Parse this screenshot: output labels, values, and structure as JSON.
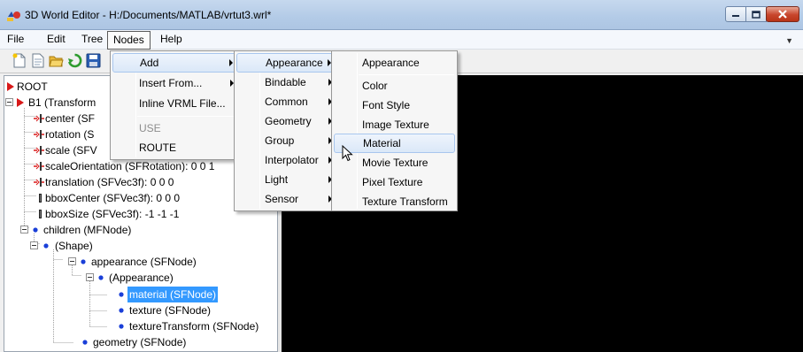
{
  "window": {
    "title": "3D World Editor - H:/Documents/MATLAB/vrtut3.wrl*"
  },
  "menubar": {
    "items": [
      "File",
      "Edit",
      "Tree",
      "Nodes",
      "Help"
    ],
    "active": "Nodes"
  },
  "tree": {
    "root": "ROOT",
    "rows": [
      "B1 (Transform",
      "center (SF",
      "rotation (S",
      "scale (SFV",
      "scaleOrientation (SFRotation): 0 0 1",
      "translation (SFVec3f): 0 0 0",
      "bboxCenter (SFVec3f): 0 0 0",
      "bboxSize (SFVec3f): -1 -1 -1",
      "children (MFNode)",
      "(Shape)",
      "appearance (SFNode)",
      "(Appearance)",
      "material (SFNode)",
      "texture (SFNode)",
      "textureTransform (SFNode)",
      "geometry (SFNode)"
    ],
    "selected": "material (SFNode)"
  },
  "nodes_menu": {
    "items": [
      "Add",
      "Insert From...",
      "Inline VRML File...",
      "USE",
      "ROUTE"
    ],
    "highlighted": "Add",
    "disabled": [
      "USE"
    ]
  },
  "add_menu": {
    "items": [
      "Appearance",
      "Bindable",
      "Common",
      "Geometry",
      "Group",
      "Interpolator",
      "Light",
      "Sensor"
    ],
    "highlighted": "Appearance"
  },
  "appearance_menu": {
    "items": [
      "Appearance",
      "Color",
      "Font Style",
      "Image Texture",
      "Material",
      "Movie Texture",
      "Pixel Texture",
      "Texture Transform"
    ],
    "highlighted": "Material"
  },
  "colors": {
    "selection": "#3399ff",
    "canvas": "#000000",
    "close_button": "#c8452c",
    "menu_highlight_border": "#a8c6ee"
  }
}
